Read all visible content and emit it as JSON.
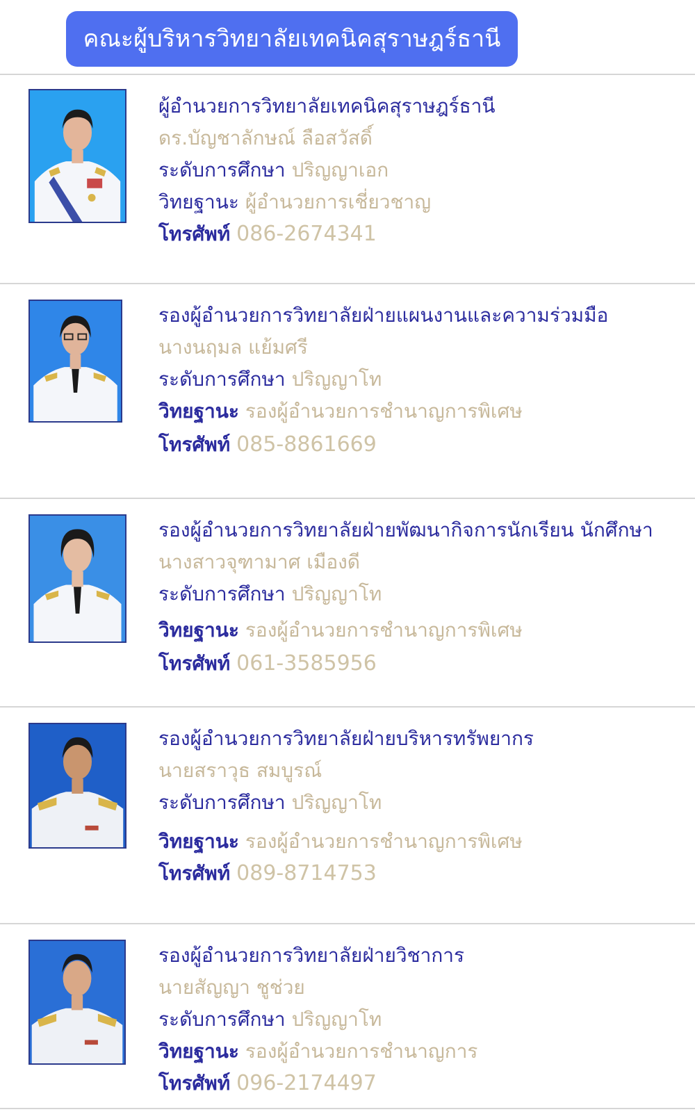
{
  "header": {
    "title": "คณะผู้บริหารวิทยาลัยเทคนิคสุราษฎร์ธานี",
    "accent_color": "#4f6ff0"
  },
  "labels": {
    "education": "ระดับการศึกษา",
    "rank": "วิทยฐานะ",
    "phone": "โทรศัพท์"
  },
  "executives": [
    {
      "position": "ผู้อำนวยการวิทยาลัยเทคนิคสุราษฎร์ธานี",
      "name": "ดร.บัญชาลักษณ์ ลือสวัสดิ์",
      "education": "ปริญญาเอก",
      "rank": "ผู้อำนวยการเชี่ยวชาญ",
      "phone": "086-2674341"
    },
    {
      "position": "รองผู้อำนวยการวิทยาลัยฝ่ายแผนงานและความร่วมมือ",
      "name": "นางนฤมล แย้มศรี",
      "education": "ปริญญาโท",
      "rank": "รองผู้อำนวยการชำนาญการพิเศษ",
      "phone": "085-8861669"
    },
    {
      "position": "รองผู้อำนวยการวิทยาลัยฝ่ายพัฒนากิจการนักเรียน นักศึกษา",
      "name": "นางสาวจุฑามาศ เมืองดี",
      "education": "ปริญญาโท",
      "rank": "รองผู้อำนวยการชำนาญการพิเศษ",
      "phone": "061-3585956"
    },
    {
      "position": "รองผู้อำนวยการวิทยาลัยฝ่ายบริหารทรัพยากร",
      "name": "นายสราวุธ สมบูรณ์",
      "education": "ปริญญาโท",
      "rank": "รองผู้อำนวยการชำนาญการพิเศษ",
      "phone": "089-8714753"
    },
    {
      "position": "รองผู้อำนวยการวิทยาลัยฝ่ายวิชาการ",
      "name": "นายสัญญา ชูช่วย",
      "education": "ปริญญาโท",
      "rank": "รองผู้อำนวยการชำนาญการ",
      "phone": "096-2174497"
    }
  ]
}
